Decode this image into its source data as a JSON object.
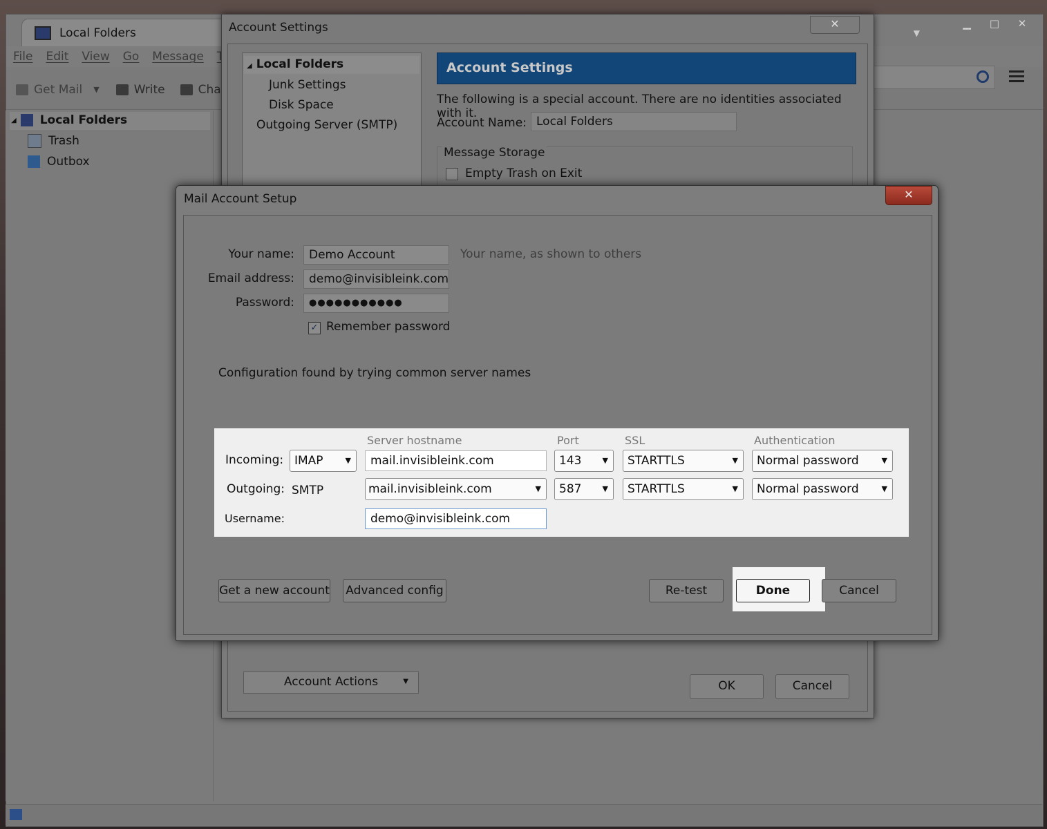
{
  "main_window": {
    "tab_title": "Local Folders",
    "menu": [
      "File",
      "Edit",
      "View",
      "Go",
      "Message",
      "Too"
    ],
    "toolbar": {
      "get_mail": "Get Mail",
      "write": "Write",
      "chat": "Chat"
    },
    "folders": {
      "root": "Local Folders",
      "trash": "Trash",
      "outbox": "Outbox"
    }
  },
  "account_settings": {
    "window_title": "Account Settings",
    "close_glyph": "✕",
    "tree": {
      "root": "Local Folders",
      "junk": "Junk Settings",
      "disk": "Disk Space",
      "smtp": "Outgoing Server (SMTP)"
    },
    "header": "Account Settings",
    "description": "The following is a special account. There are no identities associated with it.",
    "account_name_label": "Account Name:",
    "account_name_value": "Local Folders",
    "message_storage_legend": "Message Storage",
    "empty_trash_label": "Empty Trash on Exit",
    "account_actions": "Account Actions",
    "ok": "OK",
    "cancel": "Cancel"
  },
  "setup": {
    "window_title": "Mail Account Setup",
    "close_glyph": "✕",
    "your_name_label": "Your name:",
    "your_name_value": "Demo Account",
    "your_name_hint": "Your name, as shown to others",
    "email_label": "Email address:",
    "email_value": "demo@invisibleink.com",
    "password_label": "Password:",
    "password_value": "●●●●●●●●●●●",
    "remember_label": "Remember password",
    "remember_checked": true,
    "config_status": "Configuration found by trying common server names",
    "columns": {
      "hostname": "Server hostname",
      "port": "Port",
      "ssl": "SSL",
      "auth": "Authentication"
    },
    "incoming": {
      "label": "Incoming:",
      "protocol": "IMAP",
      "hostname": "mail.invisibleink.com",
      "port": "143",
      "ssl": "STARTTLS",
      "auth": "Normal password"
    },
    "outgoing": {
      "label": "Outgoing:",
      "protocol": "SMTP",
      "hostname": "mail.invisibleink.com",
      "port": "587",
      "ssl": "STARTTLS",
      "auth": "Normal password"
    },
    "username_label": "Username:",
    "username_value": "demo@invisibleink.com",
    "buttons": {
      "get_new_account": "Get a new account",
      "advanced_config": "Advanced config",
      "retest": "Re-test",
      "done": "Done",
      "cancel": "Cancel"
    }
  }
}
